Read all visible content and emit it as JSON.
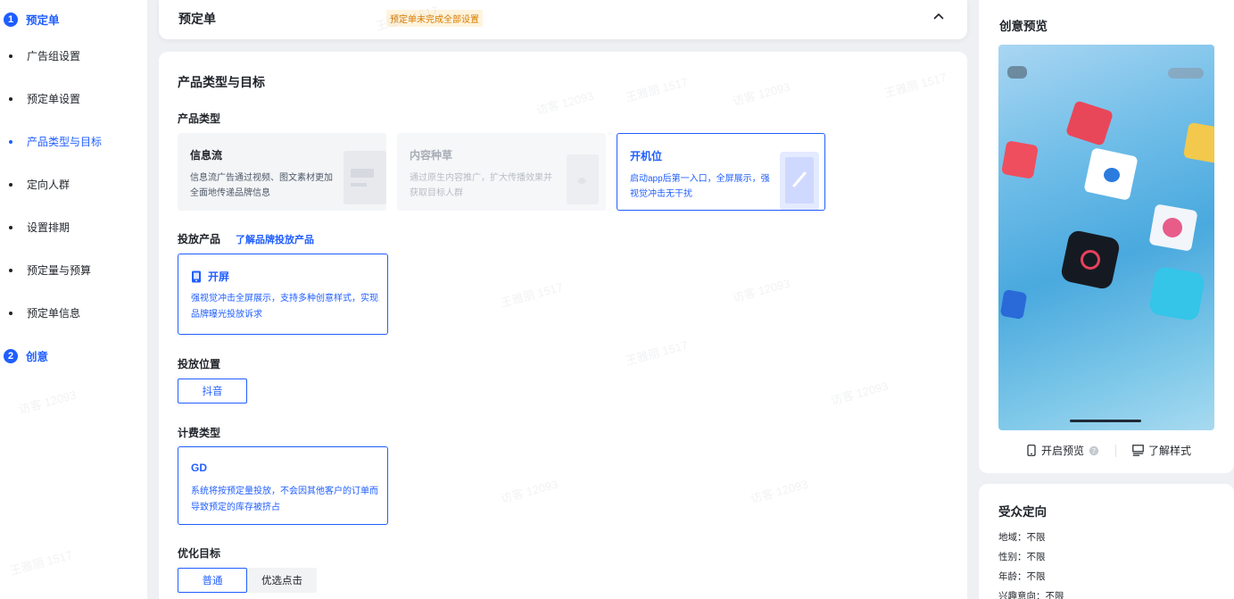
{
  "nav": {
    "step1": {
      "num": "1",
      "label": "预定单"
    },
    "items": [
      {
        "label": "广告组设置",
        "active": false
      },
      {
        "label": "预定单设置",
        "active": false
      },
      {
        "label": "产品类型与目标",
        "active": true
      },
      {
        "label": "定向人群",
        "active": false
      },
      {
        "label": "设置排期",
        "active": false
      },
      {
        "label": "预定量与预算",
        "active": false
      },
      {
        "label": "预定单信息",
        "active": false
      }
    ],
    "step2": {
      "num": "2",
      "label": "创意"
    }
  },
  "header": {
    "title": "预定单",
    "warning": "预定单未完成全部设置",
    "collapse_icon": "chevron-up-icon"
  },
  "main": {
    "section_title": "产品类型与目标",
    "product_type": {
      "label": "产品类型",
      "options": [
        {
          "title": "信息流",
          "desc": "信息流广告通过视频、图文素材更加全面地传递品牌信息",
          "state": "normal"
        },
        {
          "title": "内容种草",
          "desc": "通过原生内容推广，扩大传播效果并获取目标人群",
          "state": "disabled"
        },
        {
          "title": "开机位",
          "desc": "启动app后第一入口，全屏展示，强视觉冲击无干扰",
          "state": "selected"
        }
      ]
    },
    "delivery_product": {
      "label": "投放产品",
      "link": "了解品牌投放产品",
      "card": {
        "title": "开屏",
        "desc": "强视觉冲击全屏展示，支持多种创意样式，实现品牌曝光投放诉求",
        "icon": "phone-icon"
      }
    },
    "placement": {
      "label": "投放位置",
      "options": [
        {
          "label": "抖音",
          "selected": true
        }
      ]
    },
    "billing": {
      "label": "计费类型",
      "card": {
        "title": "GD",
        "desc": "系统将按预定量投放，不会因其他客户的订单而导致预定的库存被挤占"
      }
    },
    "goal": {
      "label": "优化目标",
      "options": [
        {
          "label": "普通",
          "selected": true
        },
        {
          "label": "优选点击",
          "selected": false
        }
      ]
    }
  },
  "preview": {
    "title": "创意预览",
    "actions": [
      {
        "label": "开启预览",
        "icon": "phone-outline-icon",
        "extra_icon": "help-icon"
      },
      {
        "label": "了解样式",
        "icon": "layout-icon"
      }
    ]
  },
  "audience": {
    "title": "受众定向",
    "rows": [
      {
        "key": "地域",
        "value": "不限"
      },
      {
        "key": "性别",
        "value": "不限"
      },
      {
        "key": "年龄",
        "value": "不限"
      },
      {
        "key": "兴趣意向",
        "value": "不限"
      }
    ]
  },
  "watermark": {
    "name": "王雅丽 1517",
    "visitor": "访客 12093"
  },
  "colors": {
    "accent": "#1f5eff",
    "warning": "#d67b00",
    "warning_bg": "#fff4dd"
  }
}
